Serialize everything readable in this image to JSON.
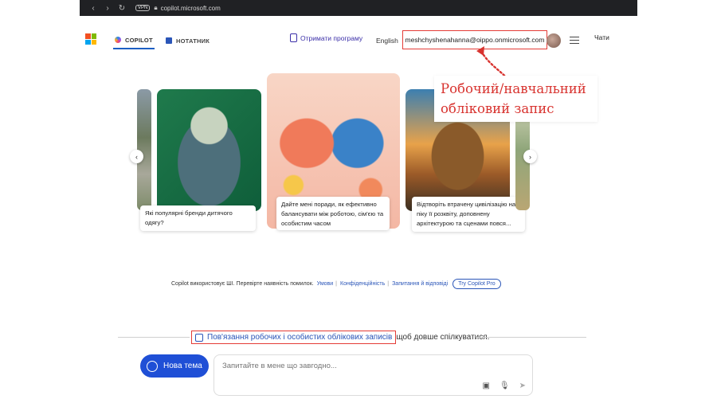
{
  "browser": {
    "vpn": "VPN",
    "url": "copilot.microsoft.com"
  },
  "header": {
    "tabs": [
      {
        "label": "COPILOT",
        "icon": "copilot-icon"
      },
      {
        "label": "НОТАТНИК",
        "icon": "notebook-icon"
      }
    ],
    "get_app": "Отримати програму",
    "language": "English",
    "account_email": "meshchyshenahanna@oippo.onmicrosoft.com",
    "chats": "Чати"
  },
  "annotation": {
    "line1": "Робочий/навчальний",
    "line2": "обліковий запис",
    "color": "#d8332f"
  },
  "carousel": {
    "cards": [
      {
        "caption": "Які популярні бренди дитячого одягу?"
      },
      {
        "caption": "Дайте мені поради, як ефективно балансувати між роботою, сім'єю та особистим часом"
      },
      {
        "caption": "Відтворіть втрачену цивілізацію на піку її розквіту, доповнену архітектурою та сценами повся..."
      }
    ]
  },
  "disclaimer": {
    "text": "Copilot використовує ШІ. Перевірте наявність помилок.",
    "links": [
      "Умови",
      "Конфіденційність",
      "Запитання й відповіді"
    ],
    "try_pro": "Try Copilot Pro"
  },
  "link_prompt": {
    "link": "Пов'язання робочих і особистих облікових записів",
    "rest": "щоб довше спілкуватися."
  },
  "composer": {
    "new_topic": "Нова тема",
    "placeholder": "Запитайте в мене що завгодно..."
  },
  "colors": {
    "accent": "#1f4fd6",
    "highlight_border": "#e43b36"
  }
}
